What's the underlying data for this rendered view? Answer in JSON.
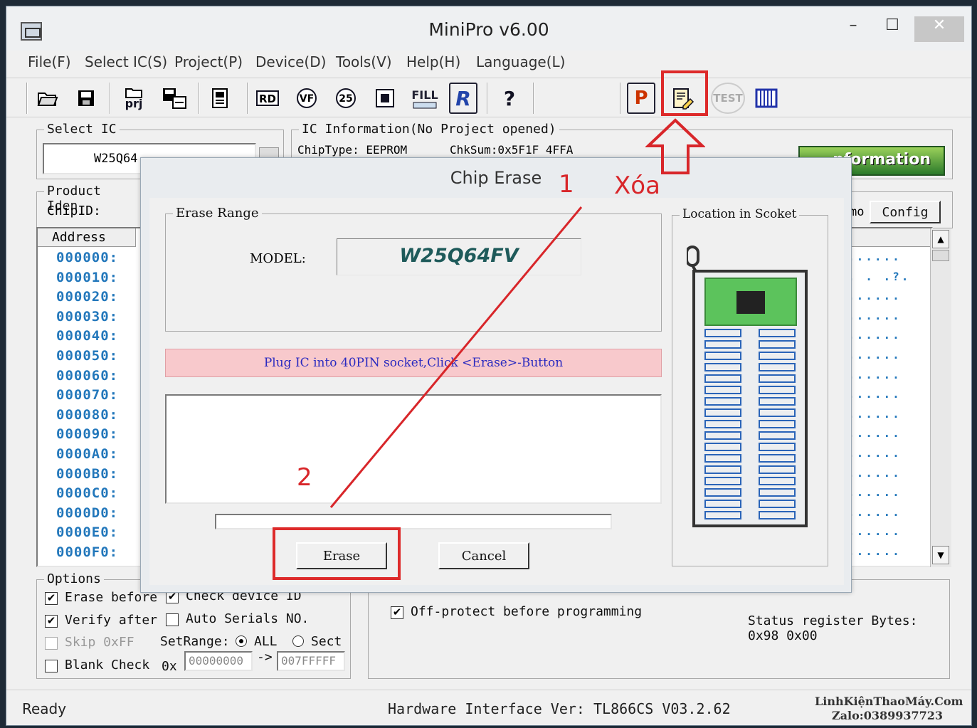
{
  "window": {
    "title": "MiniPro v6.00",
    "controls": {
      "minimize": "–",
      "maximize": "☐",
      "close": "✕"
    }
  },
  "menu": [
    "File(F)",
    "Select IC(S)",
    "Project(P)",
    "Device(D)",
    "Tools(V)",
    "Help(H)",
    "Language(L)"
  ],
  "toolbar": {
    "prj_label": "prj",
    "fill_label": "FILL",
    "r_label": "R",
    "p_label": "P",
    "test_label": "TEST",
    "help_label": "?"
  },
  "select_ic": {
    "group_label": "Select IC",
    "chip_name": "W25Q64"
  },
  "ic_info": {
    "group_label": "IC Information(No Project opened)",
    "chip_type": "ChipType: EEPROM",
    "chksum": "ChkSum:0x5F1F 4FFA",
    "info_button": "nformation"
  },
  "product_ident": {
    "group_label": "Product Iden",
    "chip_id_label": "ChipID:"
  },
  "right_panel": {
    "demo_label": "mo",
    "config_button": "Config"
  },
  "address_panel": {
    "header": "Address",
    "addresses": [
      "000000:",
      "000010:",
      "000020:",
      "000030:",
      "000040:",
      "000050:",
      "000060:",
      "000070:",
      "000080:",
      "000090:",
      "0000A0:",
      "0000B0:",
      "0000C0:",
      "0000D0:",
      "0000E0:",
      "0000F0:"
    ],
    "row2_tail": ". .  .?."
  },
  "options": {
    "group_label": "Options",
    "erase_before": "Erase before",
    "verify_after": "Verify after",
    "skip_ff": "Skip 0xFF",
    "blank_check": "Blank Check",
    "check_device_id": "Check device ID",
    "auto_serials": "Auto Serials NO.",
    "set_range": "SetRange:",
    "range_all": "ALL",
    "range_sect": "Sect",
    "hex_prefix": "0x",
    "range_start": "00000000",
    "arrow": "->",
    "range_end": "007FFFFF",
    "off_protect": "Off-protect before programming",
    "status_register_label": "Status register Bytes:",
    "status_register_value": "0x98 0x00"
  },
  "status_bar": {
    "ready": "Ready",
    "hardware": "Hardware Interface Ver: TL866CS V03.2.62",
    "watermark_line1": "LinhKiệnThaoMáy.Com",
    "watermark_line2": "Zalo:0389937723"
  },
  "dialog": {
    "title": "Chip Erase",
    "erase_range_label": "Erase Range",
    "model_label": "MODEL:",
    "model_value": "W25Q64FV",
    "message": "Plug IC into 40PIN socket,Click <Erase>-Button",
    "erase_button": "Erase",
    "cancel_button": "Cancel",
    "location_label": "Location in Scoket",
    "progress": 0
  },
  "annotations": {
    "step1": "1",
    "step2": "2",
    "xoa": "Xóa",
    "color": "#d8262a"
  }
}
